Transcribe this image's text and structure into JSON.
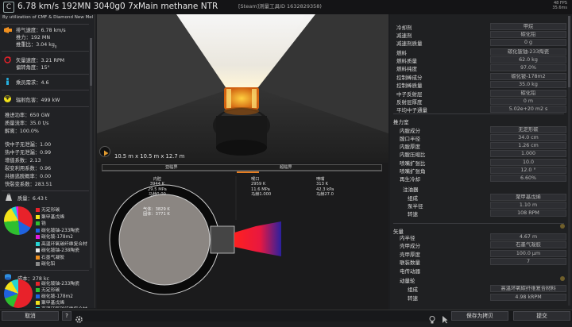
{
  "window": {
    "title": "6.78 km/s 192MN 3040g0 7xMain methane NTR",
    "steam_id": "[Steam]测量工具ID 1632829358)",
    "fps": "48 FPS\n35.6ms",
    "logo": "C"
  },
  "left": {
    "subtitle": "By utilization of CMF & Diamond New Melting Po",
    "exhaust_speed": "排气速度：6.78 km/s",
    "thrust": "推力：192 MN",
    "twr": "推重比：3.04 kg",
    "twr_sub": "0",
    "vector_speed": "矢量速度：3.21 RPM",
    "vector_deflection": "偏转角度：15°",
    "crew": "乘员需求：4.6",
    "radiation": "辐射危害：499 kW",
    "thrust_power": "推进功率：650 GW",
    "mass_flow": "质量流率：35.0 t/s",
    "dissociation": "解离：100.0%",
    "fast_neutron": "快中子无泄漏：1.00",
    "thermal_neutron": "热中子无泄漏：0.99",
    "multiplication": "增值系数：2.13",
    "fission_util": "裂变利用系数：0.96",
    "resonance": "共振逃脱概率：0.00",
    "fast_fission": "快裂变系数：283.51",
    "mass_title": "质量：6.43 t",
    "mass_legend": [
      "无定形碳",
      "聚甲基戊烯",
      "锆",
      "碳化铍铀-233陶瓷",
      "碳化铍-178m2",
      "高温环氧碳纤维复合材",
      "碳化铍铀-238陶瓷",
      "石墨气凝胶",
      "碳化铅"
    ],
    "cost_title": "成本：278 kc",
    "cost_legend": [
      "碳化铍铀-233陶瓷",
      "无定形碳",
      "碳化铍-178m2",
      "聚甲基戊烯",
      "高温环氧碳纤维复合材"
    ],
    "colors": {
      "red": "#e8222a",
      "yellow": "#f2e21a",
      "green": "#2fbf2f",
      "blue": "#1f63e0",
      "cyan": "#26d3d3",
      "magenta": "#e31be3",
      "white": "#e8e8e8",
      "orange": "#f09020",
      "gray": "#8a8a8a"
    }
  },
  "viewport": {
    "dims": "10.5 m x 10.5 m x 12.7 m"
  },
  "schematic": {
    "subsonic_label": "亚临界",
    "supersonic_label": "超临界",
    "chamber": "内腔\n3944 K\n29.5 MPa\n马赫0.00",
    "throat": "喉口\n2959 K\n11.6 MPa\n马赫1.000",
    "nozzle": "喷嘴\n313 K\n42.3 kPa\n马赫27.0",
    "gas": "气体：3829 K\n固体：3771 K"
  },
  "right": {
    "coolant": {
      "label": "冷却剂",
      "value": "甲烷"
    },
    "moderator": {
      "label": "减速剂",
      "value": "碳化铅"
    },
    "moderator_mass": {
      "label": "减速剂质量",
      "value": "0 g"
    },
    "fuel": {
      "label": "燃料",
      "value": "碳化铍铀-233陶瓷"
    },
    "fuel_mass": {
      "label": "燃料质量",
      "value": "62.0 kg"
    },
    "fuel_purity": {
      "label": "燃料纯度",
      "value": "97.0%"
    },
    "control_rod": {
      "label": "控制棒成分",
      "value": "碳化铍-178m2"
    },
    "control_rod_mass": {
      "label": "控制棒质量",
      "value": "35.0 kg"
    },
    "reflector": {
      "label": "中子反射层",
      "value": "碳化铅"
    },
    "reflector_thickness": {
      "label": "反射层厚度",
      "value": "0 m"
    },
    "avg_flux": {
      "label": "平均中子通量",
      "value": "5.02e+20 m2 s"
    },
    "chamber_section": "推力室",
    "liner": {
      "label": "内膛成分",
      "value": "无定形碳"
    },
    "throat_radius": {
      "label": "膛口半径",
      "value": "34.0 cm"
    },
    "inner_thickness": {
      "label": "内膛厚度",
      "value": "1.26 cm"
    },
    "chamber_ratio": {
      "label": "内膛压缩比",
      "value": "1.000"
    },
    "nozzle_ratio": {
      "label": "喷嘴扩张比",
      "value": "10.0"
    },
    "nozzle_angle": {
      "label": "喷嘴扩张角",
      "value": "12.0 °"
    },
    "regen": {
      "label": "再生冷却",
      "value": "6.60%"
    },
    "injector_section": "注油器",
    "injector_material": {
      "label": "组成",
      "value": "聚甲基戊烯"
    },
    "pump_radius": {
      "label": "泵半径",
      "value": "1.10 m"
    },
    "pump_speed": {
      "label": "转速",
      "value": "108 RPM"
    },
    "vector_section": "矢量",
    "inner_radius": {
      "label": "内半径",
      "value": "4.67 m"
    },
    "shell_material": {
      "label": "壳甲成分",
      "value": "石墨气凝胶"
    },
    "shell_thickness": {
      "label": "壳甲厚度",
      "value": "100.0 μm"
    },
    "engine_count": {
      "label": "联装数量",
      "value": "7"
    },
    "generator": {
      "label": "电传动器",
      "value": ""
    },
    "flywheel_section": "动量轮",
    "flywheel_material": {
      "label": "组成",
      "value": "高温环氧碳纤维复合材料"
    },
    "flywheel_speed": {
      "label": "转速",
      "value": "4.98 kRPM"
    }
  },
  "bottom": {
    "cancel": "取消",
    "help": "?",
    "save_copy": "保存为拷贝",
    "submit": "提交"
  }
}
